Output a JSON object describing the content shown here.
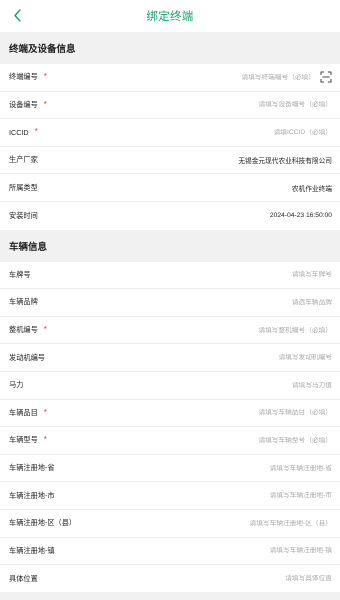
{
  "header": {
    "title": "绑定终端",
    "accent": "#16a36d"
  },
  "sections": {
    "terminal": "终端及设备信息",
    "vehicle": "车辆信息"
  },
  "terminal_rows": {
    "terminal_no": {
      "label": "终端编号",
      "placeholder": "请填写终端编号（必填）"
    },
    "device_no": {
      "label": "设备编号",
      "placeholder": "请填写设备编号（必填）"
    },
    "iccid": {
      "label": "ICCID",
      "placeholder": "请填ICCID（必填）"
    },
    "manufacturer": {
      "label": "生产厂家",
      "value": "无锡金元现代农业科技有限公司"
    },
    "type": {
      "label": "所属类型",
      "value": "农机作业终端"
    },
    "install_time": {
      "label": "安装时间",
      "value": "2024-04-23 16:50:00"
    }
  },
  "vehicle_rows": {
    "plate": {
      "label": "车牌号",
      "placeholder": "请填写车牌号"
    },
    "brand": {
      "label": "车辆品牌",
      "placeholder": "请选车辆品牌"
    },
    "machine_no": {
      "label": "整机编号",
      "placeholder": "请填写整机编号（必填）"
    },
    "engine_no": {
      "label": "发动机编号",
      "placeholder": "请填写发动机编号"
    },
    "horsepower": {
      "label": "马力",
      "placeholder": "请填写马力值"
    },
    "category": {
      "label": "车辆品目",
      "placeholder": "请填写车辆品目（必填）"
    },
    "model": {
      "label": "车辆型号",
      "placeholder": "请填写车辆型号（必填）"
    },
    "province": {
      "label": "车辆注册地-省",
      "placeholder": "请填写车辆注册地-省"
    },
    "city": {
      "label": "车辆注册地-市",
      "placeholder": "请填写车辆注册地-市"
    },
    "district": {
      "label": "车辆注册地-区（县）",
      "placeholder": "请填写车辆注册地-区（县）"
    },
    "town": {
      "label": "车辆注册地-镇",
      "placeholder": "请填写车辆注册地-镇"
    },
    "address": {
      "label": "具体位置",
      "placeholder": "请填写具体位置"
    }
  },
  "required_mark": "*",
  "icons": {
    "back": "chevron-left-icon",
    "scan": "scan-icon"
  }
}
